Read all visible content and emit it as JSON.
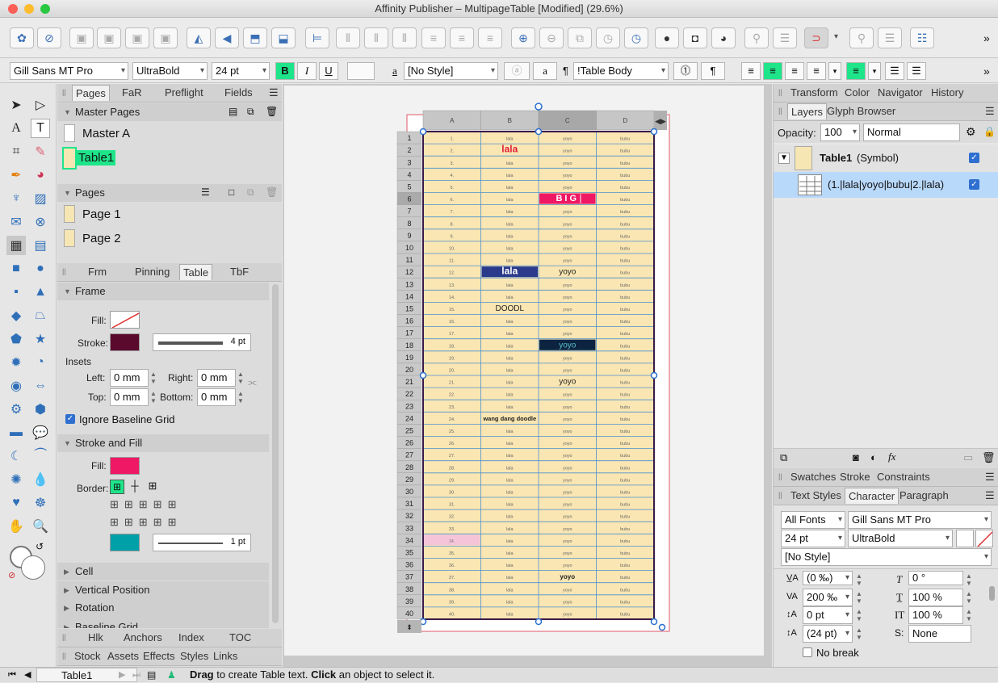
{
  "window": {
    "title": "Affinity Publisher – MultipageTable [Modified] (29.6%)"
  },
  "context_toolbar": {
    "font_family": "Gill Sans MT Pro",
    "font_style": "UltraBold",
    "font_size": "24 pt",
    "bold": "B",
    "italic": "I",
    "underline": "U",
    "char_style": "[No Style]",
    "para_style": "!Table Body",
    "a_label": "a"
  },
  "left_panel": {
    "tabs": [
      "Pages",
      "FaR",
      "Preflight",
      "Fields"
    ],
    "master_pages_title": "Master Pages",
    "masters": [
      "Master A",
      "Table1"
    ],
    "pages_title": "Pages",
    "pages": [
      "Page 1",
      "Page 2"
    ],
    "tabs2": [
      "Frm",
      "Pinning",
      "Table",
      "TbF"
    ],
    "frame_title": "Frame",
    "fill_label": "Fill:",
    "stroke_label": "Stroke:",
    "stroke_width": "4 pt",
    "insets_label": "Insets",
    "left_label": "Left:",
    "left_val": "0 mm",
    "right_label": "Right:",
    "right_val": "0 mm",
    "top_label": "Top:",
    "top_val": "0 mm",
    "bottom_label": "Bottom:",
    "bottom_val": "0 mm",
    "ignore_baseline": "Ignore Baseline Grid",
    "stroke_fill_title": "Stroke and Fill",
    "fill2_label": "Fill:",
    "border_label": "Border:",
    "border_width": "1 pt",
    "cell_title": "Cell",
    "vpos_title": "Vertical Position",
    "rotation_title": "Rotation",
    "baseline_title": "Baseline Grid",
    "tabs3": [
      "Hlk",
      "Anchors",
      "Index",
      "TOC"
    ],
    "tabs4": [
      "Stock",
      "Assets",
      "Effects",
      "Styles",
      "Links"
    ],
    "colors": {
      "stroke": "#5a0a2c",
      "fill": "#ee1864",
      "border": "#00a0a8",
      "highlight": "#1ee58a"
    }
  },
  "table": {
    "columns": [
      "A",
      "B",
      "C",
      "D"
    ],
    "rows": [
      [
        "1.",
        "lala",
        "yoyo",
        "bubu"
      ],
      [
        "2.",
        "lala",
        "yoyo",
        "bubu"
      ],
      [
        "3.",
        "lala",
        "yoyo",
        "bubu"
      ],
      [
        "4.",
        "lala",
        "yoyo",
        "bubu"
      ],
      [
        "5.",
        "lala",
        "yoyo",
        "bubu"
      ],
      [
        "6.",
        "lala",
        "BIG",
        "bubu"
      ],
      [
        "7.",
        "lala",
        "yoyo",
        "bubu"
      ],
      [
        "8.",
        "lala",
        "yoyo",
        "bubu"
      ],
      [
        "9.",
        "lala",
        "yoyo",
        "bubu"
      ],
      [
        "10.",
        "lala",
        "yoyo",
        "bubu"
      ],
      [
        "11.",
        "lala",
        "yoyo",
        "bubu"
      ],
      [
        "12.",
        "lala",
        "yoyo",
        "bubu"
      ],
      [
        "13.",
        "lala",
        "yoyo",
        "bubu"
      ],
      [
        "14.",
        "lala",
        "yoyo",
        "bubu"
      ],
      [
        "15.",
        "DOODL",
        "yoyo",
        "bubu"
      ],
      [
        "16.",
        "lala",
        "yoyo",
        "bubu"
      ],
      [
        "17.",
        "lala",
        "yoyo",
        "bubu"
      ],
      [
        "18.",
        "lala",
        "yoyo",
        "bubu"
      ],
      [
        "19.",
        "lala",
        "yoyo",
        "bubu"
      ],
      [
        "20.",
        "lala",
        "yoyo",
        "bubu"
      ],
      [
        "21.",
        "lala",
        "yoyo",
        "bubu"
      ],
      [
        "22.",
        "lala",
        "yoyo",
        "bubu"
      ],
      [
        "23.",
        "lala",
        "yoyo",
        "bubu"
      ],
      [
        "24.",
        "wang dang doodle",
        "yoyo",
        "bubu"
      ],
      [
        "25.",
        "lala",
        "yoyo",
        "bubu"
      ],
      [
        "26.",
        "lala",
        "yoyo",
        "bubu"
      ],
      [
        "27.",
        "lala",
        "yoyo",
        "bubu"
      ],
      [
        "28.",
        "lala",
        "yoyo",
        "bubu"
      ],
      [
        "29.",
        "lala",
        "yoyo",
        "bubu"
      ],
      [
        "30.",
        "lala",
        "yoyo",
        "bubu"
      ],
      [
        "31.",
        "lala",
        "yoyo",
        "bubu"
      ],
      [
        "32.",
        "lala",
        "yoyo",
        "bubu"
      ],
      [
        "33.",
        "lala",
        "yoyo",
        "bubu"
      ],
      [
        "34.",
        "lala",
        "yoyo",
        "bubu"
      ],
      [
        "35.",
        "lala",
        "yoyo",
        "bubu"
      ],
      [
        "36.",
        "lala",
        "yoyo",
        "bubu"
      ],
      [
        "37.",
        "lala",
        "yoyo",
        "bubu"
      ],
      [
        "38.",
        "lala",
        "yoyo",
        "bubu"
      ],
      [
        "39.",
        "lala",
        "yoyo",
        "bubu"
      ],
      [
        "40.",
        "lala",
        "yoyo",
        "bubu"
      ]
    ]
  },
  "right_panel": {
    "tabs_top": [
      "Transform",
      "Color",
      "Navigator",
      "History"
    ],
    "tabs_layers": [
      "Layers",
      "Glyph Browser"
    ],
    "opacity_label": "Opacity:",
    "opacity_val": "100",
    "blend": "Normal",
    "layer1": "Table1",
    "layer1_suffix": "(Symbol)",
    "layer2": "(1.|lala|yoyo|bubu|2.|lala)",
    "tabs_mid": [
      "Swatches",
      "Stroke",
      "Constraints"
    ],
    "tabs_char": [
      "Text Styles",
      "Character",
      "Paragraph"
    ],
    "font_collection": "All Fonts",
    "font_family": "Gill Sans MT Pro",
    "font_size": "24 pt",
    "font_style": "UltraBold",
    "style": "[No Style]",
    "kern": "(0 ‰)",
    "track": "200 ‰",
    "baseline": "0 pt",
    "leading": "(24 pt)",
    "shear": "0 °",
    "hscale": "100 %",
    "vscale": "100 %",
    "script": "None",
    "no_break": "No break"
  },
  "status": {
    "page": "Table1",
    "hint_bold1": "Drag",
    "hint1": " to create Table text. ",
    "hint_bold2": "Click",
    "hint2": " an object to select it."
  }
}
